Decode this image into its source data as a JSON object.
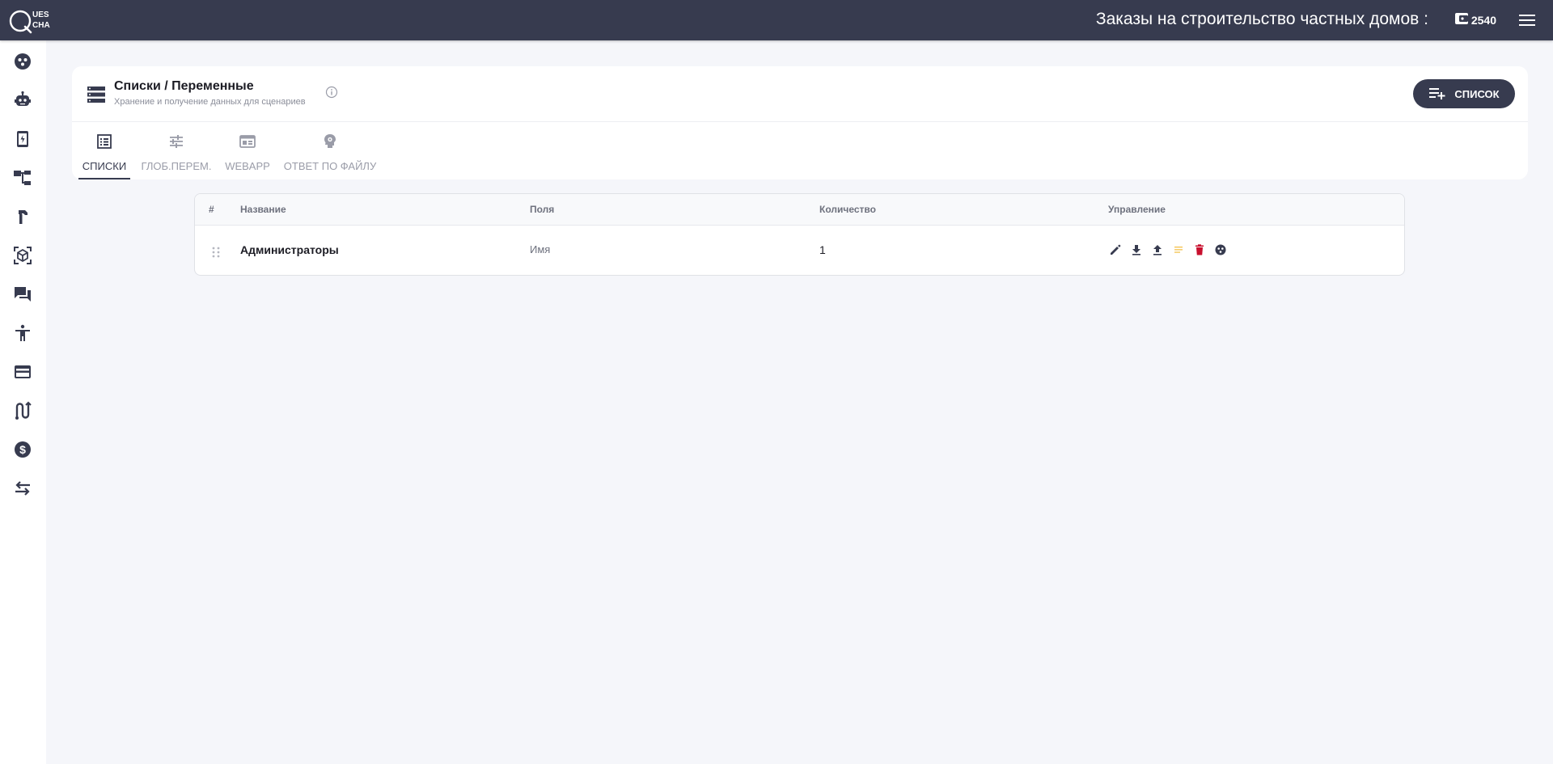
{
  "app": {
    "logo_text": "QUESCHA",
    "page_heading": "Заказы на строительство частных домов :",
    "balance": "2540"
  },
  "sidebar": {
    "items": [
      {
        "icon": "dashboard-icon"
      },
      {
        "icon": "bot-icon"
      },
      {
        "icon": "mobile-icon"
      },
      {
        "icon": "scenario-tree-icon"
      },
      {
        "icon": "hammer-icon"
      },
      {
        "icon": "cube-icon"
      },
      {
        "icon": "chat-icon"
      },
      {
        "icon": "accessibility-icon"
      },
      {
        "icon": "credit-card-icon"
      },
      {
        "icon": "route-icon"
      },
      {
        "icon": "dollar-icon"
      },
      {
        "icon": "swap-icon"
      }
    ]
  },
  "header": {
    "title": "Списки / Переменные",
    "subtitle": "Хранение и получение данных для сценариев",
    "add_button_label": "СПИСОК"
  },
  "tabs": [
    {
      "label": "СПИСКИ",
      "active": true
    },
    {
      "label": "ГЛОБ.ПЕРЕМ.",
      "active": false
    },
    {
      "label": "WEBAPP",
      "active": false
    },
    {
      "label": "ОТВЕТ ПО ФАЙЛУ",
      "active": false
    }
  ],
  "table": {
    "columns": [
      "#",
      "Название",
      "Поля",
      "Количество",
      "Управление"
    ],
    "rows": [
      {
        "name": "Администраторы",
        "fields": "Имя",
        "count": "1"
      }
    ]
  },
  "colors": {
    "topbar": "#373b4f",
    "accent": "#373b4f",
    "delete": "#c8102e",
    "highlight": "#f3c14b"
  }
}
